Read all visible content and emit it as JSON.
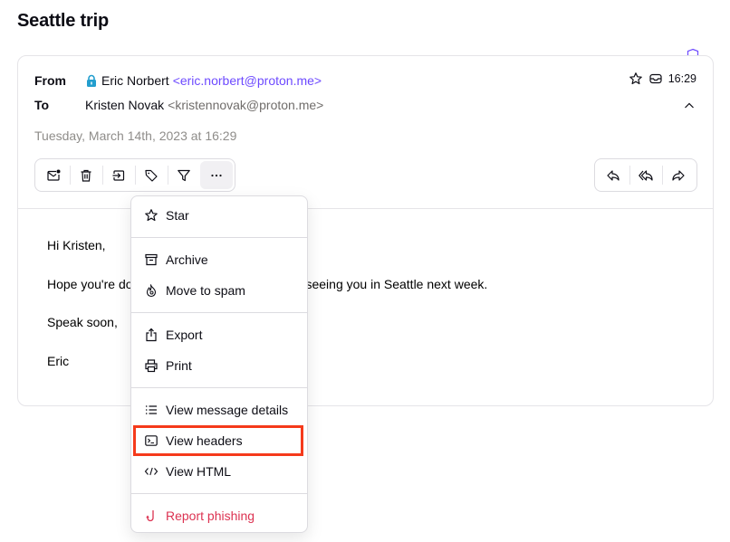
{
  "subject": "Seattle trip",
  "header": {
    "from_label": "From",
    "to_label": "To",
    "sender_name": "Eric Norbert",
    "sender_address": "<eric.norbert@proton.me>",
    "recipient_name": "Kristen Novak",
    "recipient_address": "<kristennovak@proton.me>",
    "date": "Tuesday, March 14th, 2023 at 16:29",
    "time": "16:29",
    "icons": {
      "lock": "lock-icon",
      "star": "star-icon",
      "location": "inbox-icon",
      "collapse": "chevron-up-icon",
      "shield": "shield-icon"
    }
  },
  "toolbar": {
    "buttons": [
      {
        "name": "mark-unread",
        "icon": "envelope-dot-icon"
      },
      {
        "name": "trash",
        "icon": "trash-icon"
      },
      {
        "name": "move",
        "icon": "folder-arrow-icon"
      },
      {
        "name": "label",
        "icon": "tag-icon"
      },
      {
        "name": "filter",
        "icon": "filter-icon"
      },
      {
        "name": "more",
        "icon": "ellipsis-icon",
        "active": true
      }
    ],
    "reply_buttons": [
      {
        "name": "reply",
        "icon": "reply-icon"
      },
      {
        "name": "reply-all",
        "icon": "reply-all-icon"
      },
      {
        "name": "forward",
        "icon": "forward-icon"
      }
    ]
  },
  "body": {
    "lines": [
      "Hi Kristen,",
      "Hope you're doing well! I'm looking forward to seeing you in Seattle next week.",
      "Speak soon,",
      "Eric"
    ]
  },
  "menu": {
    "items": [
      {
        "label": "Star",
        "icon": "star-icon"
      },
      {
        "label": "Archive",
        "icon": "archive-icon"
      },
      {
        "label": "Move to spam",
        "icon": "fire-icon"
      },
      {
        "label": "Export",
        "icon": "export-icon"
      },
      {
        "label": "Print",
        "icon": "printer-icon"
      },
      {
        "label": "View message details",
        "icon": "list-icon"
      },
      {
        "label": "View headers",
        "icon": "terminal-icon",
        "highlighted": true
      },
      {
        "label": "View HTML",
        "icon": "code-icon"
      },
      {
        "label": "Report phishing",
        "icon": "hook-icon",
        "danger": true
      }
    ]
  },
  "colors": {
    "accent": "#6d4aff",
    "danger": "#dc3251",
    "highlight_box": "#f53a1b",
    "lock": "#239ece"
  }
}
